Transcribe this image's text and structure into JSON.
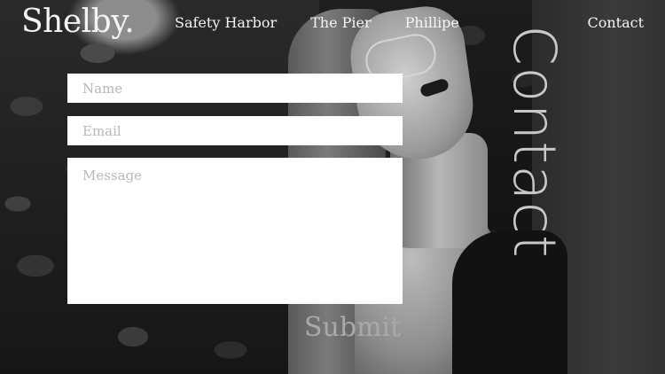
{
  "header": {
    "logo": "Shelby.",
    "nav": [
      "Safety Harbor",
      "The Pier",
      "Phillipe"
    ],
    "contact_link": "Contact"
  },
  "form": {
    "name_placeholder": "Name",
    "email_placeholder": "Email",
    "message_placeholder": "Message",
    "name_value": "",
    "email_value": "",
    "message_value": "",
    "submit_label": "Submit"
  },
  "side_title": "Contact",
  "colors": {
    "text_light": "#f4f4f4",
    "field_bg": "#ffffff",
    "placeholder": "#b8b8b8",
    "submit_text": "#a9a9a9",
    "vertical_title": "#c8c8c8"
  }
}
